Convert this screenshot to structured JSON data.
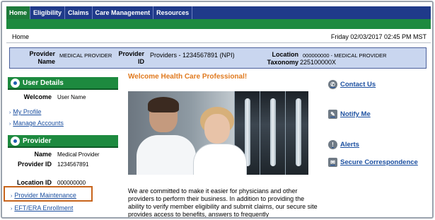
{
  "nav": {
    "items": [
      "Home",
      "Eligibility",
      "Claims",
      "Care Management",
      "Resources"
    ],
    "active": "Home"
  },
  "homebar": {
    "breadcrumb": "Home",
    "datetime": "Friday 02/03/2017 02:45 PM MST"
  },
  "provider_bar": {
    "provider_name_label": "Provider Name",
    "provider_name_value": "MEDICAL PROVIDER",
    "provider_id_label": "Provider ID",
    "provider_id_value": "Providers - 1234567891 (NPI)",
    "location_label": "Location",
    "location_value": "000000000 - MEDICAL PROVIDER",
    "taxonomy_label": "Taxonomy",
    "taxonomy_value": "225100000X"
  },
  "user_details": {
    "title": "User Details",
    "welcome_label": "Welcome",
    "welcome_value": "User Name",
    "links": [
      "My Profile",
      "Manage Accounts"
    ]
  },
  "provider_section": {
    "title": "Provider",
    "name_label": "Name",
    "name_value": "Medical Provider",
    "provider_id_label": "Provider ID",
    "provider_id_value": "1234567891",
    "location_id_label": "Location ID",
    "location_id_value": "000000000",
    "links": [
      "Provider Maintenance",
      "EFT/ERA Enrollment"
    ]
  },
  "main": {
    "welcome_title": "Welcome Health Care Professional!",
    "paragraph": "We are committed to make it easier for physicians and other providers to perform their business. In addition to providing the ability to verify member eligibility and submit claims, our secure site provides access to benefits, answers to frequently"
  },
  "right_links": [
    "Contact Us",
    "Notify Me",
    "Alerts",
    "Secure Correspondence"
  ],
  "colors": {
    "nav_blue": "#1f3a8a",
    "brand_green": "#1d8a3f",
    "link_blue": "#1b4fa0",
    "welcome_orange": "#e07a1f",
    "highlight_orange": "#c8651c",
    "provider_bar_bg": "#c9d6ef"
  }
}
